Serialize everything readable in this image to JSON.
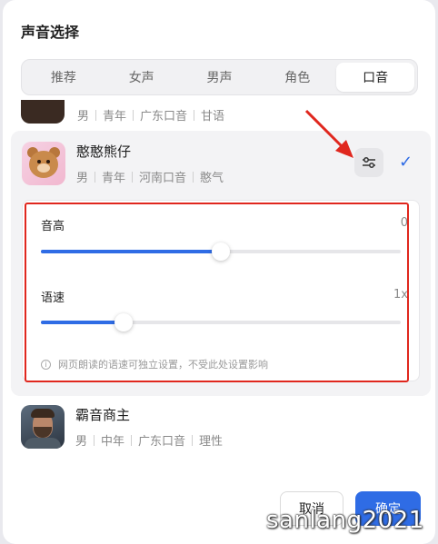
{
  "dialog": {
    "title": "声音选择"
  },
  "tabs": [
    {
      "label": "推荐",
      "active": false
    },
    {
      "label": "女声",
      "active": false
    },
    {
      "label": "男声",
      "active": false
    },
    {
      "label": "角色",
      "active": false
    },
    {
      "label": "口音",
      "active": true
    }
  ],
  "voices": [
    {
      "name": "",
      "tags": [
        "男",
        "青年",
        "广东口音",
        "甘语"
      ],
      "partial": true
    },
    {
      "name": "憨憨熊仔",
      "tags": [
        "男",
        "青年",
        "河南口音",
        "憨气"
      ],
      "selected": true
    },
    {
      "name": "霸音商主",
      "tags": [
        "男",
        "中年",
        "广东口音",
        "理性"
      ]
    }
  ],
  "settings": {
    "pitch": {
      "label": "音高",
      "value": "0",
      "level": 0.5
    },
    "speed": {
      "label": "语速",
      "value": "1x",
      "level": 0.23
    },
    "hint": "网页朗读的语速可独立设置，不受此处设置影响"
  },
  "footer": {
    "cancel_label": "取消",
    "ok_label": "确定"
  },
  "watermark": "sanlang2021",
  "colors": {
    "accent": "#2f6ce5",
    "annotation_red": "#e0271e"
  }
}
